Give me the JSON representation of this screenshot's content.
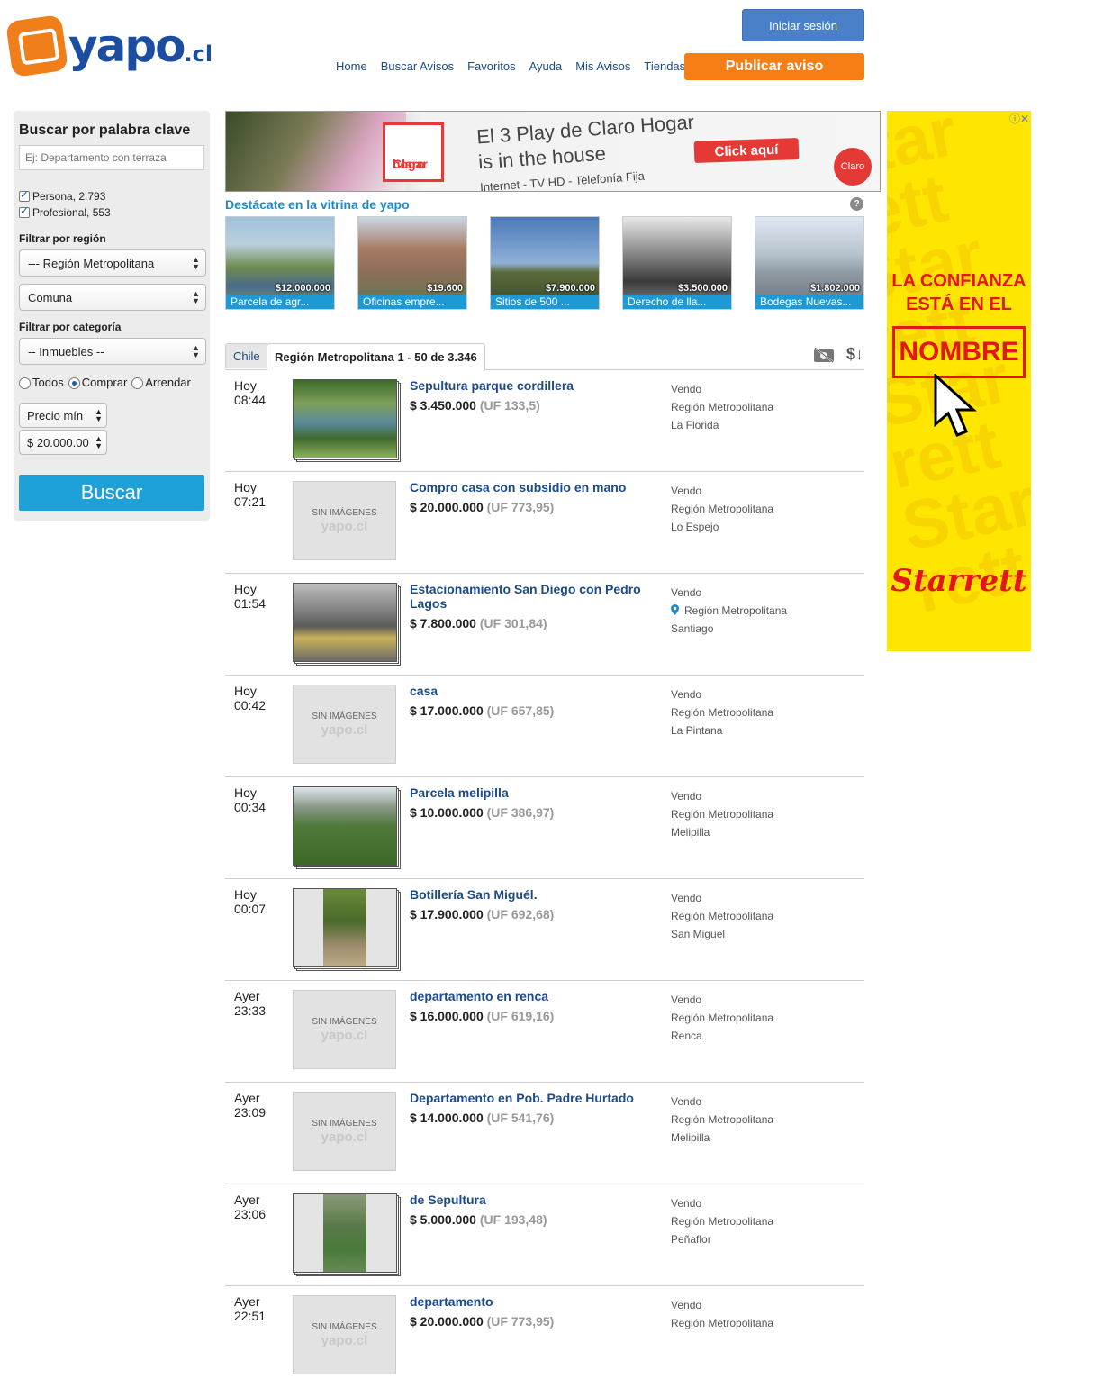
{
  "header": {
    "logo_text": "yapo",
    "logo_suffix": ".cl",
    "login_label": "Iniciar sesión",
    "nav": [
      "Home",
      "Buscar Avisos",
      "Favoritos",
      "Ayuda",
      "Mis Avisos",
      "Tiendas"
    ],
    "publish_label": "Publicar aviso"
  },
  "sidebar": {
    "title": "Buscar por palabra clave",
    "search_placeholder": "Ej: Departamento con terraza",
    "checkbox_persona": "Persona, 2.793",
    "checkbox_profesional": "Profesional, 553",
    "region_label": "Filtrar por región",
    "region_value": "--- Región Metropolitana",
    "comuna_value": "Comuna",
    "category_label": "Filtrar por categoría",
    "category_value": "-- Inmuebles --",
    "radio_todos": "Todos",
    "radio_comprar": "Comprar",
    "radio_arrendar": "Arrendar",
    "price_min": "Precio mín",
    "price_max": "$ 20.000.00",
    "search_button": "Buscar"
  },
  "top_ad": {
    "logo_line1": "Claro",
    "logo_line2": "hogar",
    "slogan_line1": "El 3 Play de Claro Hogar",
    "slogan_line2": "is in the house",
    "slogan_line3": "Internet - TV HD - Telefonía Fija",
    "cta": "Click aquí",
    "brand": "Claro"
  },
  "vitrina": {
    "title": "Destácate en la vitrina de yapo",
    "help": "?",
    "items": [
      {
        "price": "$12.000.000",
        "caption": "Parcela de agr..."
      },
      {
        "price": "$19.600",
        "caption": "Oficinas empre..."
      },
      {
        "price": "$7.900.000",
        "caption": "Sitios de 500 ..."
      },
      {
        "price": "$3.500.000",
        "caption": "Derecho de lla..."
      },
      {
        "price": "$1.802.000",
        "caption": "Bodegas Nuevas..."
      }
    ]
  },
  "tabs": {
    "chile": "Chile",
    "region": "Región Metropolitana 1 - 50 de 3.346"
  },
  "no_image": {
    "line1": "SIN IMÁGENES",
    "line2": "yapo.cl"
  },
  "listings": [
    {
      "day": "Hoy",
      "time": "08:44",
      "title": "Sepultura parque cordillera",
      "price": "$ 3.450.000",
      "uf": "(UF 133,5)",
      "type": "Vendo",
      "region": "Región Metropolitana",
      "commune": "La Florida",
      "has_image": true
    },
    {
      "day": "Hoy",
      "time": "07:21",
      "title": "Compro casa con subsidio en mano",
      "price": "$ 20.000.000",
      "uf": "(UF 773,95)",
      "type": "Vendo",
      "region": "Región Metropolitana",
      "commune": "Lo Espejo",
      "has_image": false
    },
    {
      "day": "Hoy",
      "time": "01:54",
      "title": "Estacionamiento San Diego con Pedro Lagos",
      "price": "$ 7.800.000",
      "uf": "(UF 301,84)",
      "type": "Vendo",
      "region": "Región Metropolitana",
      "commune": "Santiago",
      "has_image": true
    },
    {
      "day": "Hoy",
      "time": "00:42",
      "title": "casa",
      "price": "$ 17.000.000",
      "uf": "(UF 657,85)",
      "type": "Vendo",
      "region": "Región Metropolitana",
      "commune": "La Pintana",
      "has_image": false
    },
    {
      "day": "Hoy",
      "time": "00:34",
      "title": "Parcela melipilla",
      "price": "$ 10.000.000",
      "uf": "(UF 386,97)",
      "type": "Vendo",
      "region": "Región Metropolitana",
      "commune": "Melipilla",
      "has_image": true
    },
    {
      "day": "Hoy",
      "time": "00:07",
      "title": "Botillería San Miguél.",
      "price": "$ 17.900.000",
      "uf": "(UF 692,68)",
      "type": "Vendo",
      "region": "Región Metropolitana",
      "commune": "San Miguel",
      "has_image": true
    },
    {
      "day": "Ayer",
      "time": "23:33",
      "title": "departamento en renca",
      "price": "$ 16.000.000",
      "uf": "(UF 619,16)",
      "type": "Vendo",
      "region": "Región Metropolitana",
      "commune": "Renca",
      "has_image": false
    },
    {
      "day": "Ayer",
      "time": "23:09",
      "title": "Departamento en Pob. Padre Hurtado",
      "price": "$ 14.000.000",
      "uf": "(UF 541,76)",
      "type": "Vendo",
      "region": "Región Metropolitana",
      "commune": "Melipilla",
      "has_image": false
    },
    {
      "day": "Ayer",
      "time": "23:06",
      "title": "de Sepultura",
      "price": "$ 5.000.000",
      "uf": "(UF 193,48)",
      "type": "Vendo",
      "region": "Región Metropolitana",
      "commune": "Peñaflor",
      "has_image": true
    },
    {
      "day": "Ayer",
      "time": "22:51",
      "title": "departamento",
      "price": "$ 20.000.000",
      "uf": "(UF 773,95)",
      "type": "Vendo",
      "region": "Región Metropolitana",
      "commune": "",
      "has_image": false
    }
  ],
  "side_ad": {
    "headline_1": "LA CONFIANZA",
    "headline_2": "ESTÁ EN EL",
    "boxed": "NOMBRE",
    "brand": "Starrett"
  }
}
